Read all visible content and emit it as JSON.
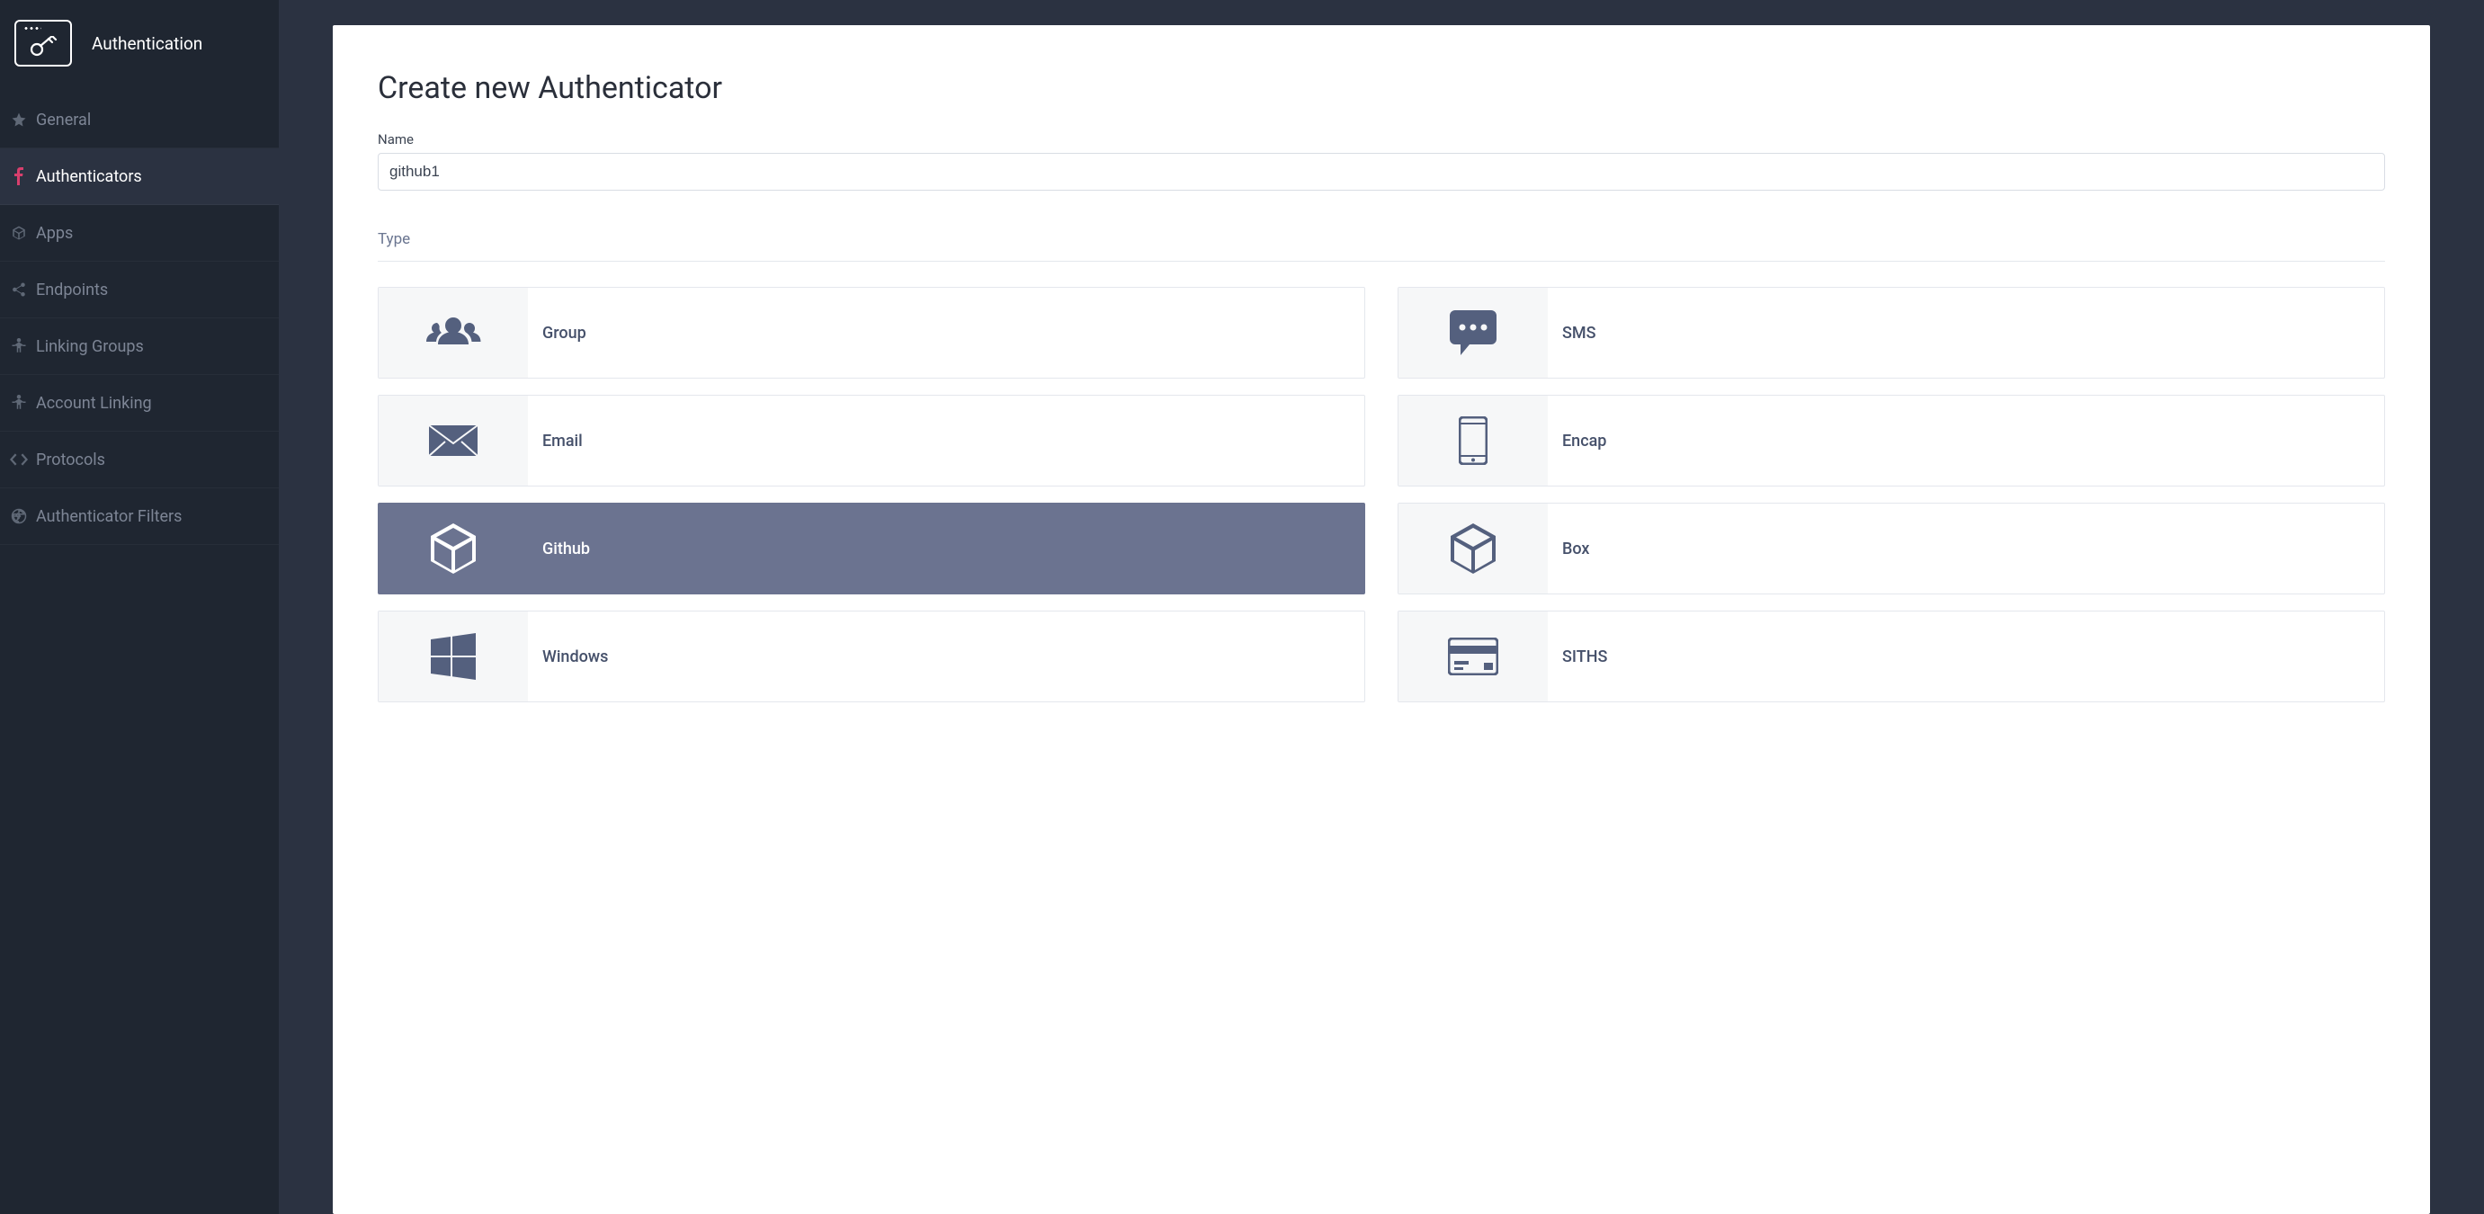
{
  "sidebar": {
    "title": "Authentication",
    "items": [
      {
        "label": "General",
        "icon": "star-icon",
        "active": false
      },
      {
        "label": "Authenticators",
        "icon": "f-icon",
        "active": true
      },
      {
        "label": "Apps",
        "icon": "cube-icon",
        "active": false
      },
      {
        "label": "Endpoints",
        "icon": "share-icon",
        "active": false
      },
      {
        "label": "Linking Groups",
        "icon": "person-icon",
        "active": false
      },
      {
        "label": "Account Linking",
        "icon": "person-icon",
        "active": false
      },
      {
        "label": "Protocols",
        "icon": "code-icon",
        "active": false
      },
      {
        "label": "Authenticator Filters",
        "icon": "enter-icon",
        "active": false
      }
    ]
  },
  "main": {
    "title": "Create new Authenticator",
    "name_label": "Name",
    "name_value": "github1",
    "type_label": "Type",
    "types": [
      {
        "label": "Group",
        "icon": "group-icon",
        "selected": false
      },
      {
        "label": "SMS",
        "icon": "sms-icon",
        "selected": false
      },
      {
        "label": "Email",
        "icon": "email-icon",
        "selected": false
      },
      {
        "label": "Encap",
        "icon": "phone-icon",
        "selected": false
      },
      {
        "label": "Github",
        "icon": "cube3d-icon",
        "selected": true
      },
      {
        "label": "Box",
        "icon": "cube3d-icon",
        "selected": false
      },
      {
        "label": "Windows",
        "icon": "windows-icon",
        "selected": false
      },
      {
        "label": "SITHS",
        "icon": "card-icon",
        "selected": false
      }
    ]
  }
}
